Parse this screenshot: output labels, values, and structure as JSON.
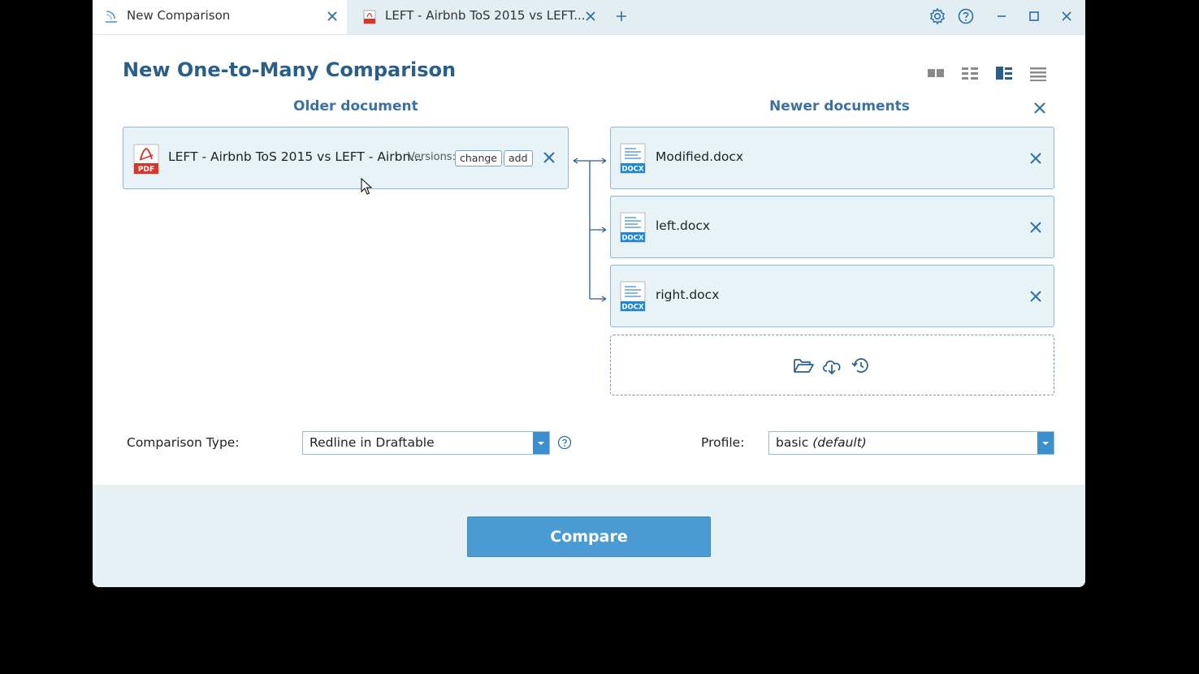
{
  "tabs": [
    {
      "label": "New Comparison",
      "icon": "draftable-logo-icon",
      "active": true
    },
    {
      "label": "LEFT - Airbnb ToS 2015 vs LEFT...",
      "icon": "pdf-file-icon",
      "active": false
    }
  ],
  "toolbar": {
    "icons": [
      "gear-icon",
      "help-circle-icon",
      "minimize-icon",
      "maximize-icon",
      "close-icon"
    ]
  },
  "page": {
    "title": "New One-to-Many Comparison",
    "view_modes": [
      "side-by-side-view-icon",
      "grid-view-icon",
      "list-detail-view-icon",
      "list-view-icon"
    ],
    "active_view": "list-detail-view-icon"
  },
  "older": {
    "header": "Older document",
    "file": {
      "name": "LEFT - Airbnb ToS 2015 vs LEFT - Airbn...",
      "type": "PDF",
      "versions_label": "Versions:",
      "change_label": "change",
      "add_label": "add"
    }
  },
  "newer": {
    "header": "Newer documents",
    "files": [
      {
        "name": "Modified.docx",
        "type": "DOCX"
      },
      {
        "name": "left.docx",
        "type": "DOCX"
      },
      {
        "name": "right.docx",
        "type": "DOCX"
      }
    ],
    "drop_zone_icons": [
      "folder-open-icon",
      "cloud-download-icon",
      "history-icon"
    ]
  },
  "options": {
    "comparison_type_label": "Comparison Type:",
    "comparison_type_value": "Redline in Draftable",
    "profile_label": "Profile:",
    "profile_value": "basic",
    "profile_suffix": "(default)"
  },
  "actions": {
    "compare_label": "Compare"
  },
  "colors": {
    "accent": "#4a9bd4",
    "title": "#2a5f8a",
    "card_bg": "#e7f3f7",
    "card_border": "#8cb6d4",
    "pdf_red": "#d9362b",
    "docx_blue": "#1e88d2"
  }
}
